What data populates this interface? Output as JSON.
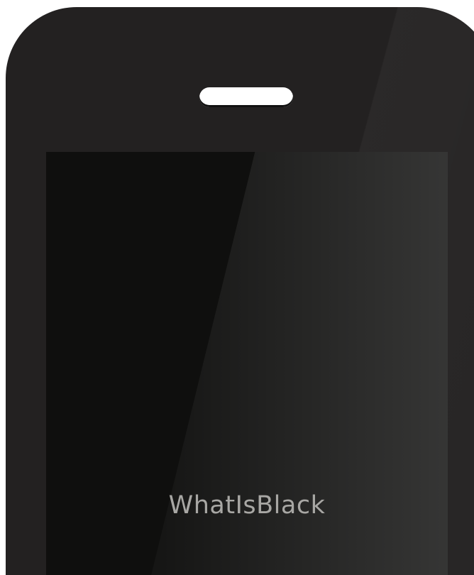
{
  "device": {
    "screen_text": "WhatIsBlack",
    "colors": {
      "body": "#232121",
      "screen": "#0f0f0e",
      "speaker": "#ffffff",
      "label": "#a8a7a4"
    },
    "icons": [
      "speaker-grille"
    ]
  }
}
